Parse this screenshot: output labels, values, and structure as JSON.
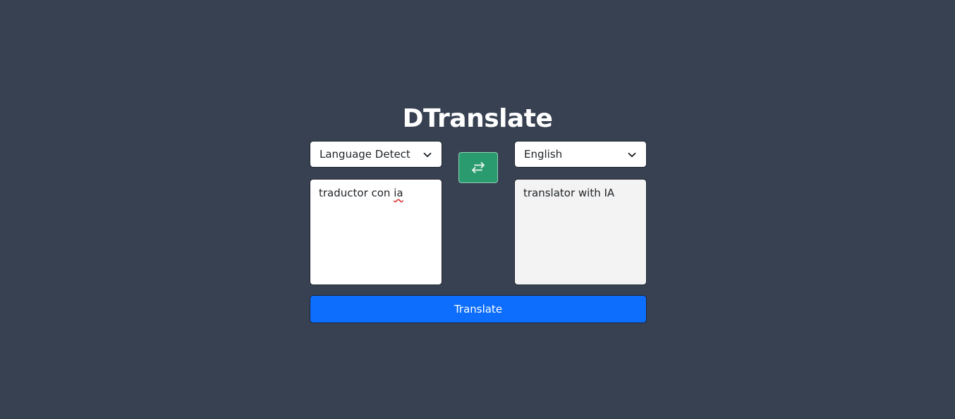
{
  "app": {
    "title": "DTranslate"
  },
  "source": {
    "language": "Language Detect",
    "text_before_error": "traductor con ",
    "text_misspelled": "ia"
  },
  "target": {
    "language": "English",
    "text": "translator with IA"
  },
  "actions": {
    "translate_label": "Translate",
    "swap_icon": "swap-arrows-icon"
  },
  "colors": {
    "background": "#384152",
    "swap_button": "#2a9a6f",
    "translate_button": "#0d6efd",
    "output_background": "#f3f3f3"
  }
}
